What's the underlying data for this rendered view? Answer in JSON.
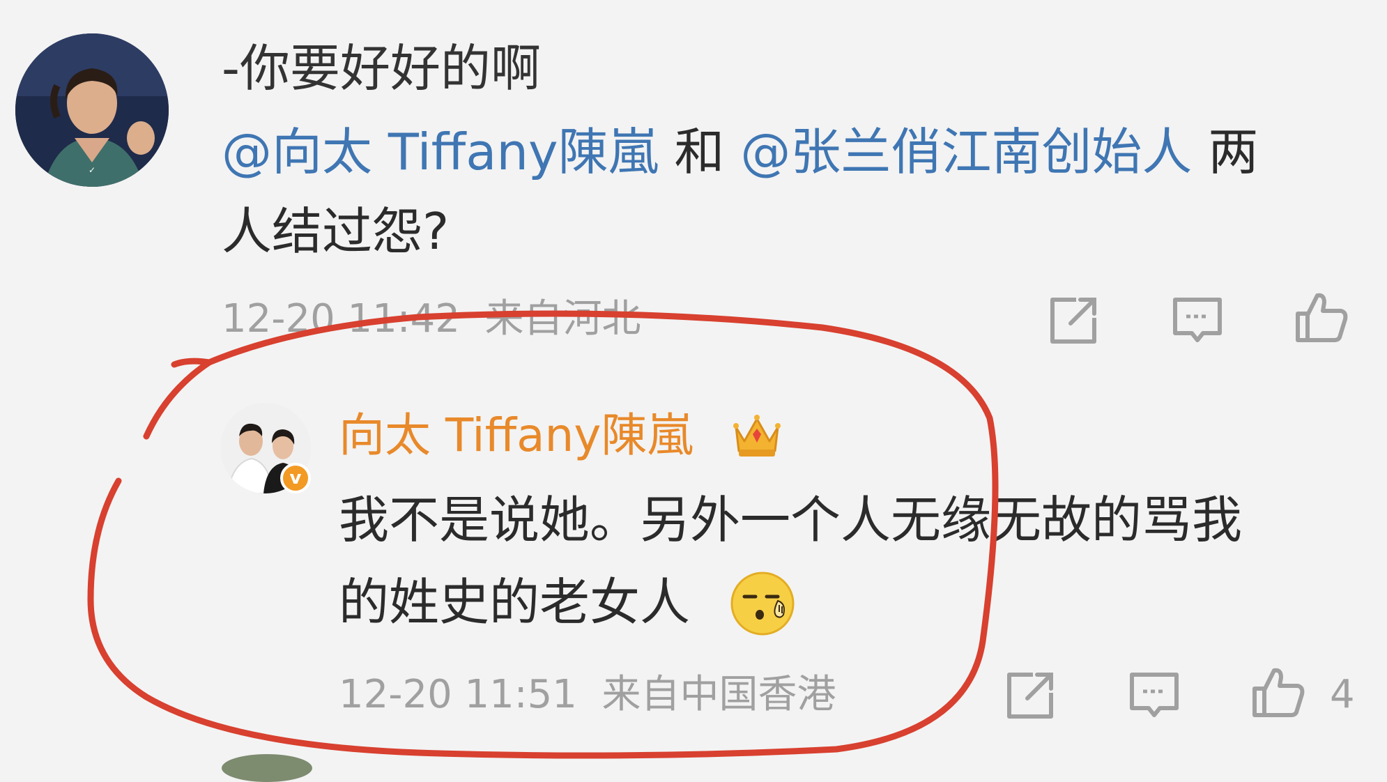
{
  "comment": {
    "text_line1": "-你要好好的啊",
    "mention1": "@向太 Tiffany陳嵐",
    "connector": " 和 ",
    "mention2": "@张兰俏江南创始人",
    "text_tail": " 两",
    "text_line3": "人结过怨?",
    "time": "12-20 11:42",
    "location": "来自河北",
    "icons": [
      "share-icon",
      "comment-icon",
      "like-icon"
    ]
  },
  "reply": {
    "author": "向太 Tiffany陳嵐",
    "verified_badge": "v",
    "line1": "我不是说她。另外一个人无缘无故的骂我",
    "line2": "的姓史的老女人",
    "time": "12-20 11:51",
    "location": "来自中国香港",
    "like_count": "4",
    "icons": [
      "crown-icon",
      "yawn-emoji-icon",
      "share-icon",
      "comment-icon",
      "like-icon"
    ]
  },
  "colors": {
    "background": "#f3f3f3",
    "mention": "#3f76b3",
    "author_name": "#e8892a",
    "meta_text": "#a0a0a0",
    "annotation": "#d8402f"
  }
}
